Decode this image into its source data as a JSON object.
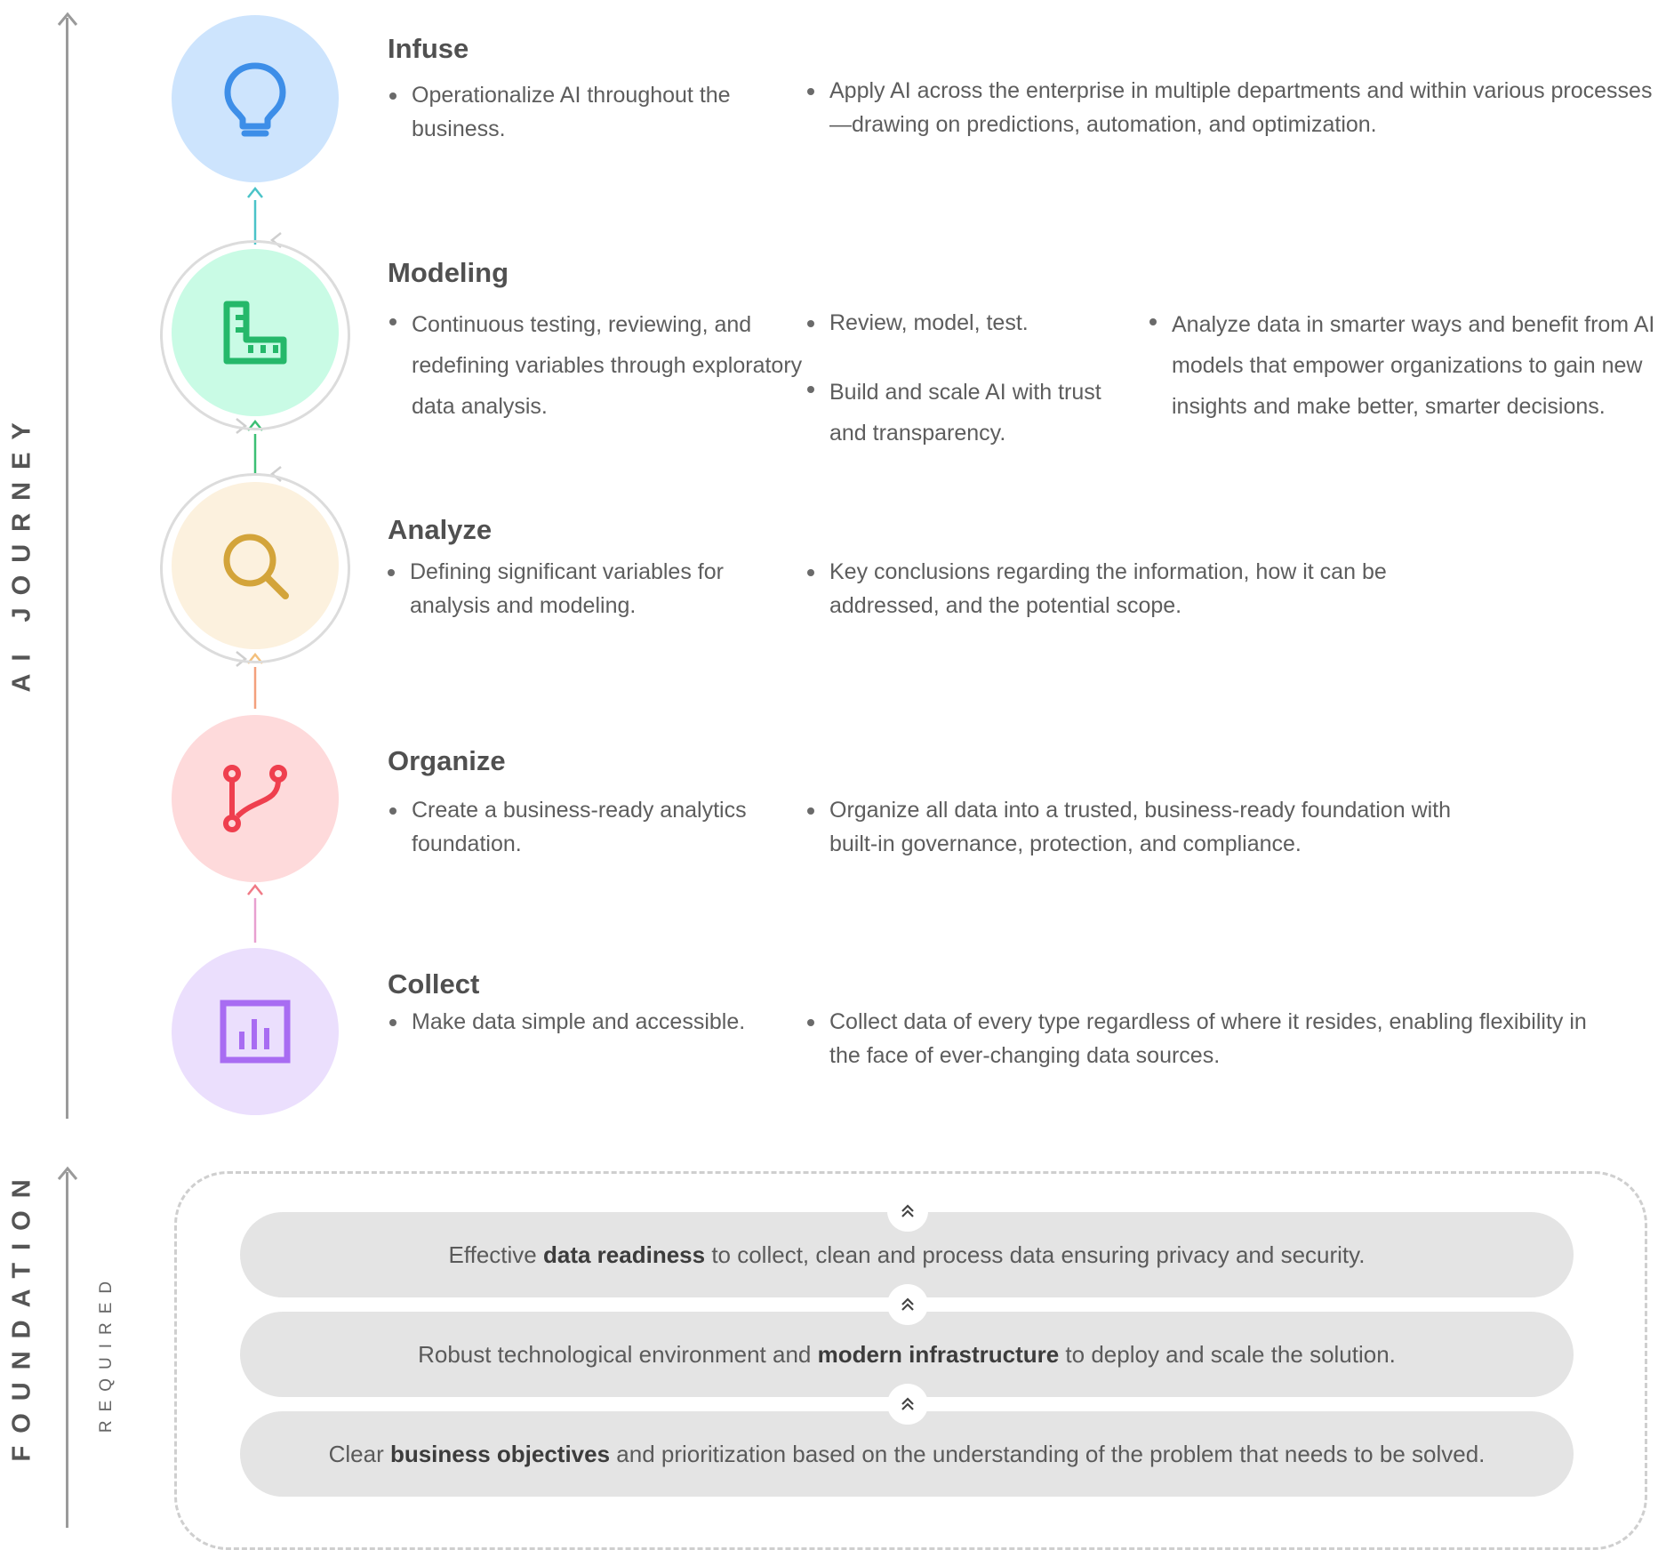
{
  "side_labels": {
    "ai_journey": "AI JOURNEY",
    "foundation": "FOUNDATION",
    "required": "REQUIRED"
  },
  "stages": {
    "infuse": {
      "title": "Infuse",
      "icon": "lightbulb-icon",
      "color": "#3d8ee8",
      "bg": "#cde4fd",
      "col1": [
        "Operationalize AI throughout the business."
      ],
      "col2": [
        "Apply AI across the enterprise in multiple departments and within various processes—drawing on predictions, automation, and optimization."
      ]
    },
    "modeling": {
      "title": "Modeling",
      "icon": "ruler-icon",
      "color": "#25b86a",
      "bg": "#c9fbe5",
      "col1": [
        "Continuous testing, reviewing, and redefining variables through exploratory data analysis."
      ],
      "col2": [
        "Review, model, test.",
        "Build and scale AI with trust and transparency."
      ],
      "col3": [
        "Analyze data in smarter ways and benefit from AI models that empower organizations to gain new insights and make better, smarter decisions."
      ]
    },
    "analyze": {
      "title": "Analyze",
      "icon": "magnifier-icon",
      "color": "#d3a43a",
      "bg": "#fcf1de",
      "col1": [
        "Defining significant variables for analysis and modeling."
      ],
      "col2": [
        "Key conclusions regarding the information, how it can be addressed, and the potential scope."
      ]
    },
    "organize": {
      "title": "Organize",
      "icon": "branch-icon",
      "color": "#ef3f4e",
      "bg": "#fedadb",
      "col1": [
        "Create a business-ready analytics foundation."
      ],
      "col2": [
        "Organize all data into a trusted, business-ready foundation with built-in governance, protection, and compliance."
      ]
    },
    "collect": {
      "title": "Collect",
      "icon": "bar-chart-icon",
      "color": "#a86cf2",
      "bg": "#ebdffd",
      "col1": [
        "Make data simple and accessible."
      ],
      "col2": [
        "Collect data of every type regardless of where it resides, enabling flexibility in the face of ever-changing data sources."
      ]
    }
  },
  "foundation_items": {
    "readiness": {
      "pre": "Effective ",
      "bold": "data readiness",
      "post": " to collect, clean and process data ensuring privacy and security."
    },
    "infrastructure": {
      "pre": "Robust technological environment and ",
      "bold": "modern infrastructure",
      "post": " to deploy and scale the solution."
    },
    "objectives": {
      "pre": "Clear ",
      "bold": "business objectives",
      "post": " and prioritization based on the understanding of the problem that needs to be solved."
    }
  }
}
